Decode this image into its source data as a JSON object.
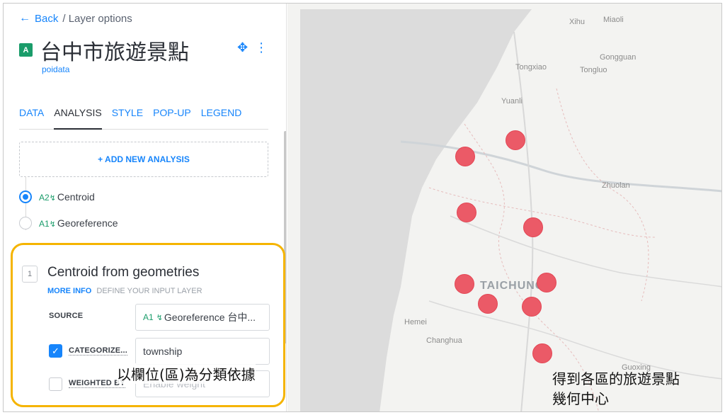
{
  "header": {
    "back_label": "Back",
    "breadcrumb": "/ Layer options",
    "layer_badge": "A",
    "layer_title": "台中市旅遊景點",
    "layer_source": "poidata"
  },
  "tabs": [
    {
      "label": "DATA",
      "active": false
    },
    {
      "label": "ANALYSIS",
      "active": true
    },
    {
      "label": "STYLE",
      "active": false
    },
    {
      "label": "POP-UP",
      "active": false
    },
    {
      "label": "LEGEND",
      "active": false
    }
  ],
  "add_analysis_label": "+ ADD NEW ANALYSIS",
  "analysis_steps": [
    {
      "code": "A2",
      "label": "Centroid",
      "selected": true
    },
    {
      "code": "A1",
      "label": "Georeference",
      "selected": false
    }
  ],
  "analysis_form": {
    "step_number": "1",
    "title": "Centroid from geometries",
    "more_info": "MORE INFO",
    "define_input": "DEFINE YOUR INPUT LAYER",
    "source_label": "SOURCE",
    "source_code": "A1",
    "source_value": "Georeference 台中...",
    "categorize_label": "CATEGORIZE...",
    "categorize_checked": true,
    "categorize_value": "township",
    "weighted_label": "WEIGHTED BY",
    "weighted_checked": false,
    "weighted_placeholder": "Enable weight"
  },
  "annotations": {
    "left": "以欄位(區)為分類依據",
    "right_line1": "得到各區的旅遊景點",
    "right_line2": "幾何中心"
  },
  "map": {
    "city_label": "TAICHUNG",
    "places": [
      "Xihu",
      "Miaoli",
      "Gongguan",
      "Tongxiao",
      "Tongluo",
      "Yuanli",
      "Zhuolan",
      "Hemei",
      "Changhua",
      "Guoxing"
    ],
    "marker_color": "#eb5a67",
    "sea_color": "#dcdcdc",
    "poi_count": 11
  },
  "colors": {
    "accent": "#1785fb",
    "analysis_green": "#1a9c6a",
    "highlight": "#f5b400"
  }
}
